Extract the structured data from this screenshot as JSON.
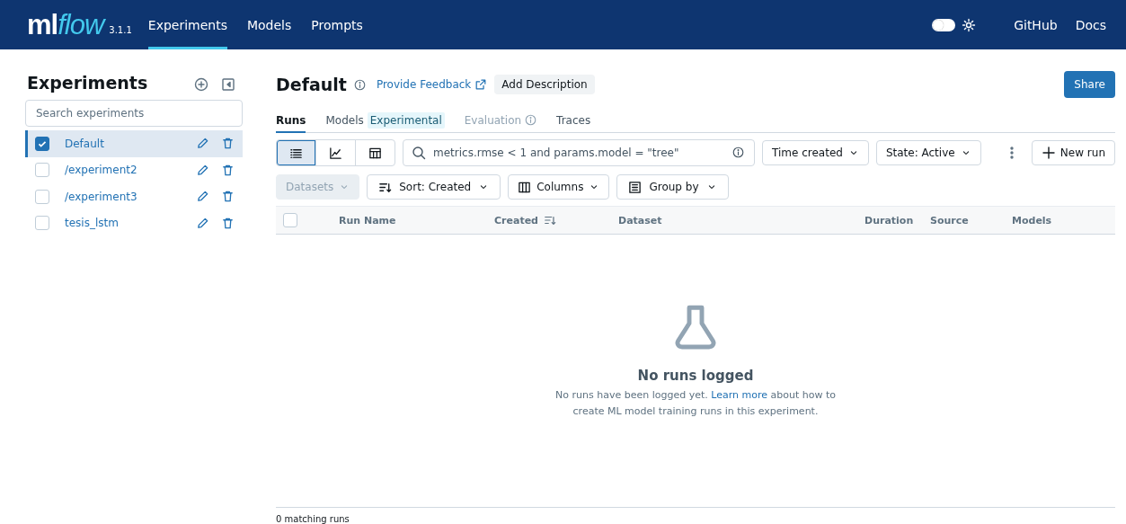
{
  "header": {
    "logo": {
      "primary": "ml",
      "accent": "flow"
    },
    "version": "3.1.1",
    "nav": [
      {
        "label": "Experiments",
        "selected": true
      },
      {
        "label": "Models",
        "selected": false
      },
      {
        "label": "Prompts",
        "selected": false
      }
    ],
    "theme_toggle": {
      "on": false
    },
    "links": [
      "GitHub",
      "Docs"
    ]
  },
  "sidebar": {
    "title": "Experiments",
    "search": {
      "placeholder": "Search experiments"
    },
    "items": [
      {
        "name": "Default",
        "checked": true,
        "selected": true
      },
      {
        "name": "/experiment2",
        "checked": false,
        "selected": false
      },
      {
        "name": "/experiment3",
        "checked": false,
        "selected": false
      },
      {
        "name": "tesis_lstm",
        "checked": false,
        "selected": false
      }
    ]
  },
  "experiment": {
    "title": "Default",
    "feedback_link": "Provide Feedback",
    "add_description": "Add Description",
    "share": "Share",
    "tabs": [
      {
        "label": "Runs",
        "selected": true,
        "disabled": false
      },
      {
        "label": "Models",
        "badge": "Experimental",
        "selected": false,
        "disabled": false
      },
      {
        "label": "Evaluation",
        "info": true,
        "selected": false,
        "disabled": true
      },
      {
        "label": "Traces",
        "selected": false,
        "disabled": false
      }
    ],
    "view_modes": [
      {
        "kind": "list",
        "selected": true
      },
      {
        "kind": "chart",
        "selected": false
      },
      {
        "kind": "table",
        "selected": false
      }
    ],
    "search": {
      "placeholder": "metrics.rmse < 1 and params.model = \"tree\""
    },
    "time_filter": "Time created",
    "state_filter": "State: Active",
    "new_run": "New run",
    "datasets": {
      "label": "Datasets",
      "disabled": true
    },
    "sort": "Sort: Created",
    "columns": "Columns",
    "group_by": "Group by",
    "table": {
      "select_all": false,
      "columns": [
        {
          "label": "Run Name",
          "sorted": false
        },
        {
          "label": "Created",
          "sorted": true
        },
        {
          "label": "Dataset",
          "sorted": false
        },
        {
          "label": "Duration",
          "sorted": false
        },
        {
          "label": "Source",
          "sorted": false
        },
        {
          "label": "Models",
          "sorted": false
        }
      ]
    },
    "empty": {
      "title": "No runs logged",
      "before": "No runs have been logged yet. ",
      "link": "Learn more",
      "after": " about how to create ML model training runs in this experiment."
    },
    "footer": "0 matching runs"
  }
}
